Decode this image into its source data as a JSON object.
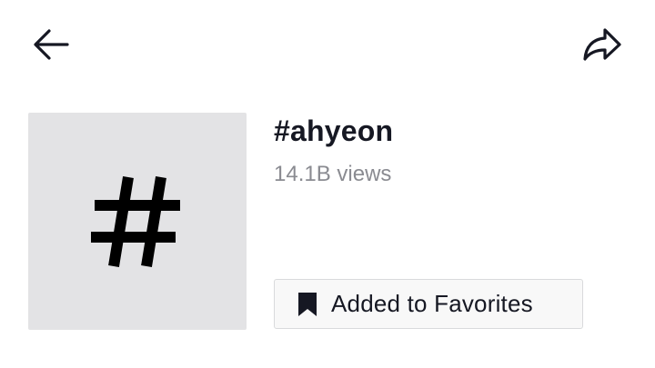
{
  "header": {
    "back_icon": "arrow-left-icon",
    "share_icon": "share-arrow-icon"
  },
  "hashtag": {
    "thumbnail_icon": "hashtag-icon",
    "title": "#ahyeon",
    "views": "14.1B views"
  },
  "favorites_button": {
    "icon": "bookmark-filled-icon",
    "label": "Added to Favorites"
  },
  "colors": {
    "background": "#ffffff",
    "text_primary": "#161823",
    "text_secondary": "#8a8b91",
    "thumbnail_bg": "#e3e3e5",
    "button_bg": "#f8f8f8",
    "button_border": "#d9dadc"
  }
}
